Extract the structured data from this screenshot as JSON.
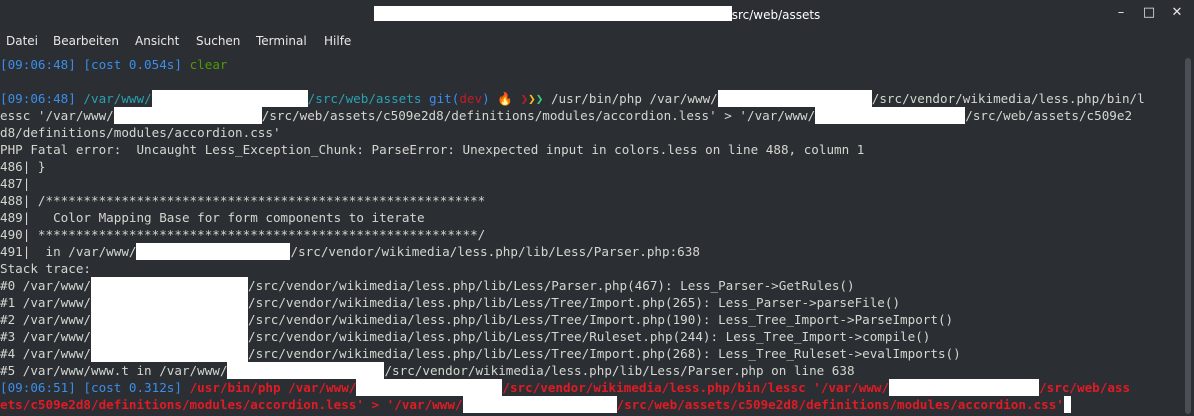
{
  "window": {
    "title_suffix": "src/web/assets",
    "controls": [
      "–",
      "□",
      "✕"
    ]
  },
  "menu": [
    "Datei",
    "Bearbeiten",
    "Ansicht",
    "Suchen",
    "Terminal",
    "Hilfe"
  ],
  "terminal": {
    "line1": {
      "ts": "[09:06:48] [cost 0.054s]",
      "cmd": "clear"
    },
    "prompt": {
      "ts": "[09:06:48]",
      "path_a": "/var/www/",
      "path_b": "/src/web/assets",
      "git": "git(",
      "branch": "dev",
      "git_close": ")",
      "fire": "🔥",
      "arrow1": "❯",
      "arrow2": "❯",
      "arrow3": "❯",
      "cmd_a": "/usr/bin/php /var/www/",
      "cmd_b": "/src/vendor/wikimedia/less.php/bin/l"
    },
    "wrap1_a": "essc '/var/www/",
    "wrap1_b": "/src/web/assets/c509e2d8/definitions/modules/accordion.less' > '/var/www/",
    "wrap1_c": "/src/web/assets/c509e2",
    "wrap2": "d8/definitions/modules/accordion.css'",
    "error": "PHP Fatal error:  Uncaught Less_Exception_Chunk: ParseError: Unexpected input in colors.less on line 488, column 1",
    "src486": "486| }",
    "src487": "487|",
    "src488": "488| /**********************************************************",
    "src489": "489|   Color Mapping Base for form components to iterate",
    "src490": "490| **********************************************************/",
    "src491_a": "491|  in /var/www/",
    "src491_b": "/src/vendor/wikimedia/less.php/lib/Less/Parser.php:638",
    "stack_title": "Stack trace:",
    "stack": [
      {
        "pre": "#0 /var/www/",
        "post": "/src/vendor/wikimedia/less.php/lib/Less/Parser.php(467): Less_Parser->GetRules()"
      },
      {
        "pre": "#1 /var/www/",
        "post": "/src/vendor/wikimedia/less.php/lib/Less/Tree/Import.php(265): Less_Parser->parseFile()"
      },
      {
        "pre": "#2 /var/www/",
        "post": "/src/vendor/wikimedia/less.php/lib/Less/Tree/Import.php(190): Less_Tree_Import->ParseImport()"
      },
      {
        "pre": "#3 /var/www/",
        "post": "/src/vendor/wikimedia/less.php/lib/Less/Tree/Ruleset.php(244): Less_Tree_Import->compile()"
      },
      {
        "pre": "#4 /var/www/",
        "post": "/src/vendor/wikimedia/less.php/lib/Less/Tree/Import.php(268): Less_Tree_Ruleset->evalImports()"
      },
      {
        "pre": "#5 /var/www/www.t in /var/www/",
        "post": "/src/vendor/wikimedia/less.php/lib/Less/Parser.php on line 638"
      }
    ],
    "last": {
      "ts": "[09:06:51] [cost 0.312s]",
      "cmd_a": "/usr/bin/php /var/www/",
      "cmd_b": "/src/vendor/wikimedia/less.php/bin/lessc '/var/www/",
      "cmd_c": "/src/web/ass",
      "cmd_d": "ets/c509e2d8/definitions/modules/accordion.less' > '/var/www/",
      "cmd_e": "/src/web/assets/c509e2d8/definitions/modules/accordion.css'"
    }
  }
}
